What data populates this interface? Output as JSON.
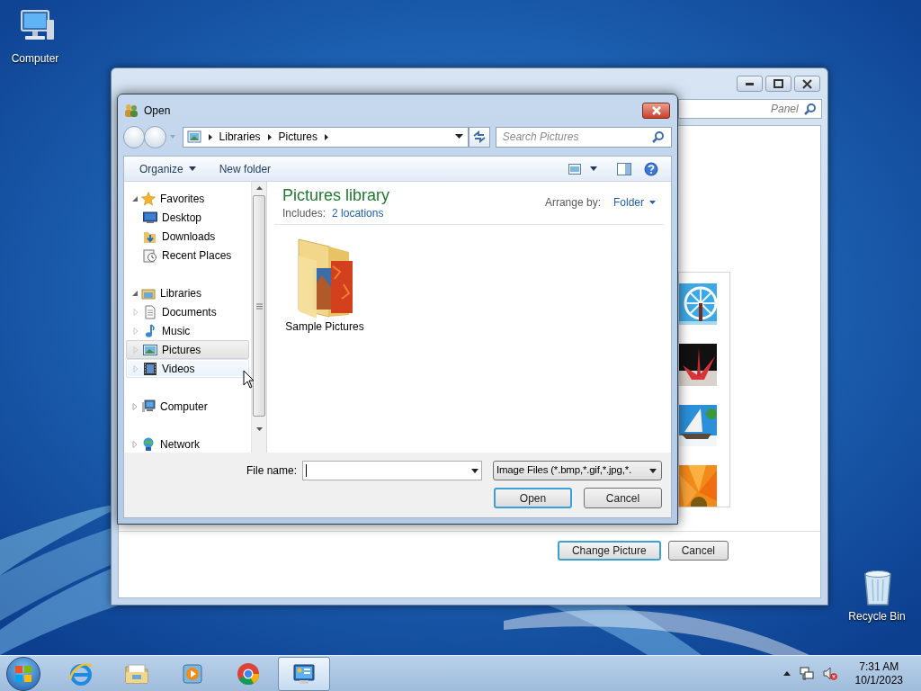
{
  "desktop_icons": [
    {
      "label": "Computer"
    },
    {
      "label": "Recycle Bin"
    }
  ],
  "background_window": {
    "search": {
      "placeholder": "Panel"
    },
    "buttons": [
      {
        "label": "Change Picture",
        "default": true
      },
      {
        "label": "Cancel",
        "default": false
      }
    ]
  },
  "open_dialog": {
    "title": "Open",
    "address": [
      "Libraries",
      "Pictures"
    ],
    "search": {
      "placeholder": "Search Pictures"
    },
    "toolbar": [
      {
        "label": "Organize",
        "dropdown": true
      },
      {
        "label": "New folder",
        "dropdown": false
      }
    ],
    "nav_pane": [
      {
        "label": "Favorites",
        "expanded": true,
        "children": [
          {
            "label": "Desktop",
            "selected": false,
            "hovered": false
          },
          {
            "label": "Downloads",
            "selected": false,
            "hovered": false
          },
          {
            "label": "Recent Places",
            "selected": false,
            "hovered": false
          }
        ]
      },
      {
        "label": "Libraries",
        "expanded": true,
        "children": [
          {
            "label": "Documents",
            "selected": false,
            "hovered": false,
            "expanded": false
          },
          {
            "label": "Music",
            "selected": false,
            "hovered": false,
            "expanded": false
          },
          {
            "label": "Pictures",
            "selected": true,
            "hovered": false,
            "expanded": false
          },
          {
            "label": "Videos",
            "selected": false,
            "hovered": true,
            "expanded": false
          }
        ]
      },
      {
        "label": "Computer",
        "expanded": false
      },
      {
        "label": "Network",
        "expanded": false
      }
    ],
    "library": {
      "title": "Pictures library",
      "includes_label": "Includes:",
      "includes_link": "2 locations",
      "arrange_label": "Arrange by:",
      "arrange_value": "Folder"
    },
    "items": [
      {
        "label": "Sample Pictures"
      }
    ],
    "file_name": {
      "label": "File name:"
    },
    "file_type": "Image Files (*.bmp,*.gif,*.jpg,*.",
    "buttons": [
      {
        "label": "Open",
        "default": true
      },
      {
        "label": "Cancel",
        "default": false
      }
    ]
  },
  "taskbar": {
    "apps": [
      {
        "active": false
      },
      {
        "active": false
      },
      {
        "active": false
      },
      {
        "active": false
      },
      {
        "active": true
      }
    ],
    "clock": {
      "time": "7:31 AM",
      "date": "10/1/2023"
    }
  }
}
